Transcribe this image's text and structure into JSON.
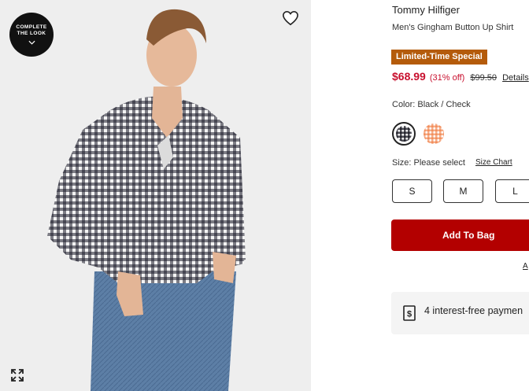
{
  "image_panel": {
    "badge_line1": "COMPLETE",
    "badge_line2": "THE LOOK",
    "icons": [
      "chevron-down-icon",
      "heart-icon",
      "expand-icon"
    ]
  },
  "product": {
    "brand": "Tommy Hilfiger",
    "name": "Men's Gingham Button Up Shirt",
    "promo_badge": "Limited-Time Special",
    "price": "$68.99",
    "discount": "(31% off)",
    "original_price": "$99.50",
    "details_link": "Details"
  },
  "color": {
    "label": "Color: Black / Check",
    "swatches": [
      "Black / Check",
      "Orange Check"
    ]
  },
  "size": {
    "label": "Size: Please select",
    "chart_link": "Size Chart",
    "options": [
      "S",
      "M",
      "L"
    ]
  },
  "cta": {
    "add_to_bag": "Add To Bag",
    "partial_link": "A"
  },
  "payment": {
    "text": "4 interest-free paymen"
  },
  "colors": {
    "promo_bg": "#b45b0b",
    "price_red": "#c8102e",
    "button_red": "#b30000"
  }
}
